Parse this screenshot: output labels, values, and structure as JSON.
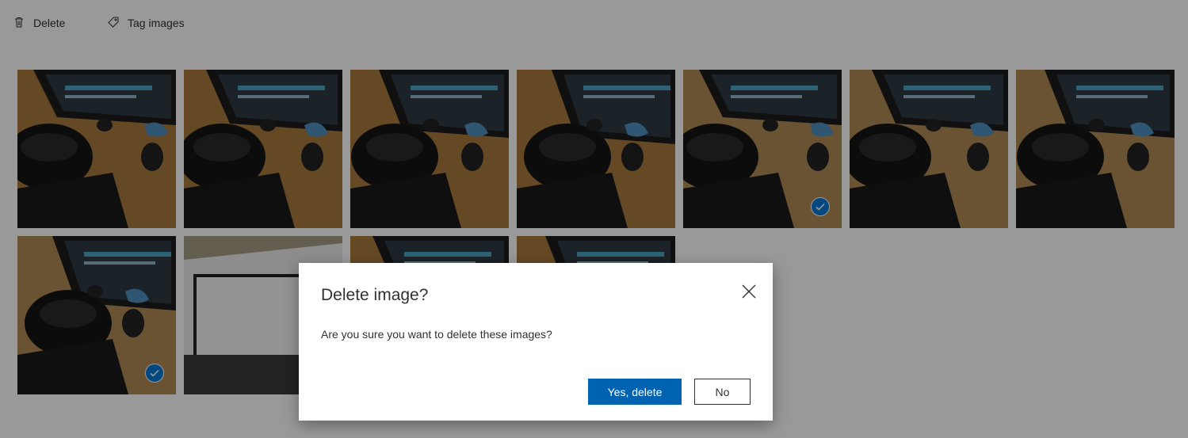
{
  "toolbar": {
    "delete_label": "Delete",
    "tag_label": "Tag images"
  },
  "images": [
    {
      "kind": "desk",
      "selected": false
    },
    {
      "kind": "desk",
      "selected": false
    },
    {
      "kind": "desk",
      "selected": false
    },
    {
      "kind": "desk",
      "selected": false
    },
    {
      "kind": "desk-bright",
      "selected": true
    },
    {
      "kind": "desk-bright",
      "selected": false
    },
    {
      "kind": "desk-bright",
      "selected": false
    },
    {
      "kind": "desk-bright",
      "selected": true
    },
    {
      "kind": "room",
      "selected": false
    },
    {
      "kind": "desk",
      "selected": false
    },
    {
      "kind": "desk",
      "selected": false
    }
  ],
  "dialog": {
    "title": "Delete image?",
    "message": "Are you sure you want to delete these images?",
    "confirm_label": "Yes, delete",
    "cancel_label": "No"
  },
  "colors": {
    "primary": "#0063b1",
    "check": "#0078d4",
    "overlay": "rgba(0,0,0,0.4)"
  }
}
